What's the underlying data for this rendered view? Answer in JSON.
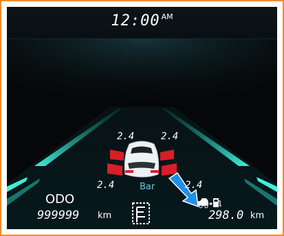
{
  "clock": {
    "time": "12:00",
    "ampm": "AM"
  },
  "tire_pressure": {
    "front_left": "2.4",
    "front_right": "2.4",
    "rear_left": "2.4",
    "rear_right": "2.4",
    "unit": "Bar"
  },
  "odometer": {
    "label": "ODO",
    "value": "999999",
    "unit": "km"
  },
  "range": {
    "value": "298.0",
    "unit": "km"
  },
  "icons": [
    "car-top-view-icon",
    "tire-warning-icon",
    "gear-indicator-icon",
    "range-fuel-icon",
    "callout-arrow-icon"
  ],
  "colors": {
    "frame": "#f28a2e",
    "lane": "#2ee0c8",
    "tire_alert": "#e0202a",
    "unit": "#5fc9d8",
    "arrow": "#1e90e8"
  }
}
